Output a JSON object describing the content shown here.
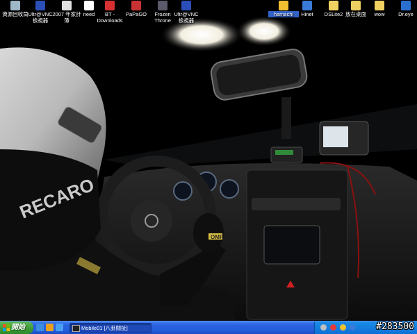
{
  "desktop": {
    "icons": [
      {
        "label": "資源回收筒",
        "glyph_color": "#9fb8c8"
      },
      {
        "label": "Ultr@VNC 檢視器",
        "glyph_color": "#2b4fb8"
      },
      {
        "label": "2007 年家計簿",
        "glyph_color": "#e0e0e0"
      },
      {
        "label": "need",
        "glyph_color": "#ffffff"
      },
      {
        "label": "BT - Downloads",
        "glyph_color": "#d83030"
      },
      {
        "label": "PaPaGO",
        "glyph_color": "#c83232"
      },
      {
        "label": "Frozen Throne",
        "glyph_color": "#5a5a6a"
      },
      {
        "label": "Ultr@VNC 檢視器",
        "glyph_color": "#2b4fb8"
      },
      {
        "label": "hamachi",
        "glyph_color": "#f0c030",
        "selected": true
      },
      {
        "label": "Hinet",
        "glyph_color": "#3a7ad8"
      },
      {
        "label": "DSLite2",
        "glyph_color": "#f0d060"
      },
      {
        "label": "放在桌面",
        "glyph_color": "#f0d060"
      },
      {
        "label": "wow",
        "glyph_color": "#f0d060"
      },
      {
        "label": "Dr.eye",
        "glyph_color": "#2b6fd0"
      }
    ]
  },
  "wallpaper": {
    "helmet_text": "RECARO",
    "glove_text": "OMP",
    "description_colors": {
      "bg": "#000000",
      "dash": "#1a1a1a"
    }
  },
  "taskbar": {
    "start_label": "開始",
    "task_button_label": "Mobile01 [八卦閒扯]",
    "watermark": "#283500"
  }
}
